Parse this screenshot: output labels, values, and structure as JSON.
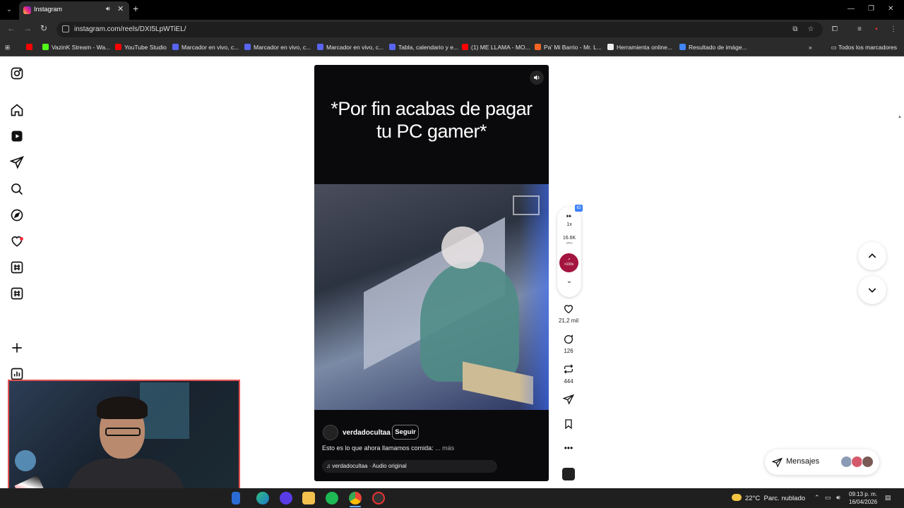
{
  "browser": {
    "tab_title": "Instagram",
    "tab_audio_icon": "speaker-icon",
    "url": "instagram.com/reels/DXI5LpWTiEL/",
    "bookmarks": [
      {
        "label": "",
        "icon_color": "#ff0000"
      },
      {
        "label": "VazinK Stream - Wa...",
        "icon_color": "#53fc18"
      },
      {
        "label": "YouTube Studio",
        "icon_color": "#ff0000"
      },
      {
        "label": "Marcador en vivo, c...",
        "icon_color": "#5865f2"
      },
      {
        "label": "Marcador en vivo, c...",
        "icon_color": "#5865f2"
      },
      {
        "label": "Marcador en vivo, c...",
        "icon_color": "#5865f2"
      },
      {
        "label": "Tabla, calendario y e...",
        "icon_color": "#5865f2"
      },
      {
        "label": "(1) ME LLAMA - MO...",
        "icon_color": "#ff0000"
      },
      {
        "label": "Pa' Mi Barrio - Mr. L...",
        "icon_color": "#f26522"
      },
      {
        "label": "Herramienta online...",
        "icon_color": "#eeeeee"
      },
      {
        "label": "Resultado de imáge...",
        "icon_color": "#4285f4"
      }
    ],
    "all_bookmarks": "Todos los marcadores"
  },
  "sidebar": {
    "items": [
      {
        "name": "instagram-logo-icon"
      },
      {
        "name": "home-icon"
      },
      {
        "name": "reels-icon"
      },
      {
        "name": "direct-messages-icon"
      },
      {
        "name": "search-icon"
      },
      {
        "name": "explore-icon"
      },
      {
        "name": "notifications-heart-icon"
      },
      {
        "name": "hashtag-icon"
      },
      {
        "name": "hashtag-icon"
      },
      {
        "name": "create-plus-icon"
      },
      {
        "name": "dashboard-icon"
      }
    ]
  },
  "reel": {
    "caption_line1": "*Por fin acabas de pagar",
    "caption_line2": "tu PC gamer*",
    "author": "verdadocultaa",
    "follow_label": "Seguir",
    "description": "Esto es lo que ahora llamamos comida:",
    "more_label": "... más",
    "audio": "verdadocultaa · Audio original"
  },
  "extension": {
    "badge": "IG",
    "speed": "1x",
    "views": "16.6K",
    "views_unit": "VPH",
    "trend_label": ">100x"
  },
  "actions": {
    "likes": "21,2 mil",
    "comments": "126",
    "reposts": "444"
  },
  "messages": {
    "label": "Mensajes",
    "avatar_colors": [
      "#8c9bb5",
      "#d4596b",
      "#7a5a55"
    ]
  },
  "taskbar": {
    "temperature": "22°C",
    "weather": "Parc. nublado",
    "time": "09:13 p. m.",
    "date": "16/04/2026"
  },
  "colors": {
    "accent_trend": "#a3143e",
    "notification_dot": "#ff3040",
    "webcam_border": "#e35353"
  }
}
